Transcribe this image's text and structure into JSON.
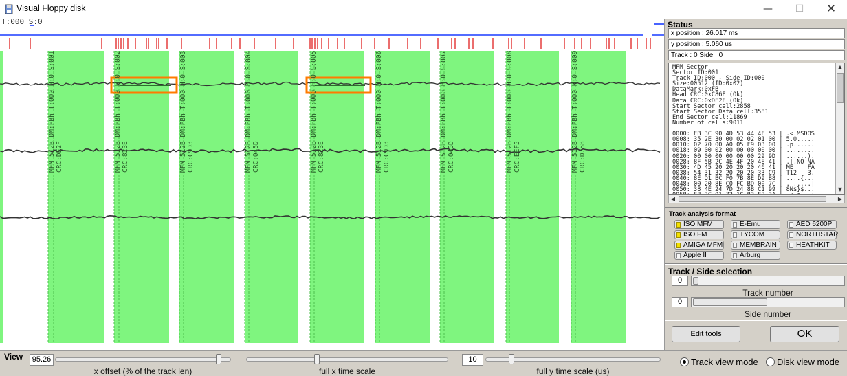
{
  "window": {
    "title": "Visual Floppy disk",
    "minimize": "—",
    "maximize": "☐",
    "close": "✕"
  },
  "trackview": {
    "readout": "T:000 S:0",
    "sector_labels": [
      "MFM 512B DM:FBh T:000 H:0 S:001 CRC:DE2F",
      "MFM 512B DM:FBh T:000 H:0 S:002 CRC:823E",
      "MFM 512B DM:FBh T:000 H:0 S:003 CRC:C9D3",
      "MFM 512B DM:FBh T:000 H:0 S:004 CRC:045D",
      "MFM 512B DM:FBh T:000 H:0 S:005 CRC:823E",
      "MFM 512B DM:FBh T:000 H:0 S:006 CRC:C9D3",
      "MFM 512B DM:FBh T:000 H:0 S:007 CRC:045D",
      "MFM 512B DM:FBh T:000 H:0 S:008 CRC:EEF5",
      "MFM 512B DM:FBh T:000 H:0 S:009 CRC:D758"
    ],
    "colors": {
      "sector": "#7ff57f",
      "marker": "#e02020",
      "highlight": "#ff7b00",
      "baseline": "#1a3cff"
    }
  },
  "status": {
    "title": "Status",
    "x_position": "x position : 26.017 ms",
    "y_position": "y position : 5.060 us",
    "track_side": "Track : 0 Side : 0",
    "info_lines": [
      "MFM Sector",
      "Sector ID:001",
      "Track ID:000 - Side ID:000",
      "Size:00512 (ID:0x02)",
      "DataMark:0xFB",
      "Head CRC:0xC86F (Ok)",
      "Data CRC:0xDE2F (Ok)",
      "Start Sector cell:2858",
      "Start Sector Data cell:3581",
      "End Sector cell:11869",
      "Number of cells:9011",
      "",
      "0000: EB 3C 90 4D 53 44 4F 53 | .<.MSDOS",
      "0008: 35 2E 30 00 02 02 01 00 | 5.0.....",
      "0010: 02 70 00 A0 05 F9 03 00 | .p......",
      "0018: 09 00 02 00 00 00 00 00 | ........",
      "0020: 00 00 00 00 00 00 29 9D | ......).",
      "0028: 8F 5B 2C 4E 4F 20 4E 41 | .[,NO NA",
      "0030: 4D 45 20 20 20 20 46 41 | ME    FA",
      "0038: 54 31 32 20 20 20 33 C9 | T12   3.",
      "0040: 8E D1 BC F0 7B 8E D9 B8 | ....{...",
      "0048: 00 20 8E C0 FC BD 00 7C | . .....|",
      "0050: 38 4E 24 7D 24 8B C1 99 | 8N$}$...",
      "0058: E8 3C 01 72 1C 83 EB 3A | .<.r...:"
    ]
  },
  "format": {
    "title": "Track analysis format",
    "buttons": [
      {
        "label": "ISO MFM",
        "on": true
      },
      {
        "label": "E-Emu",
        "on": false
      },
      {
        "label": "AED 6200P",
        "on": false
      },
      {
        "label": "ISO FM",
        "on": true
      },
      {
        "label": "TYCOM",
        "on": false
      },
      {
        "label": "NORTHSTAR",
        "on": false
      },
      {
        "label": "AMIGA MFM",
        "on": true
      },
      {
        "label": "MEMBRAIN",
        "on": false
      },
      {
        "label": "HEATHKIT",
        "on": false
      },
      {
        "label": "Apple II",
        "on": false
      },
      {
        "label": "Arburg",
        "on": false
      }
    ]
  },
  "trackside": {
    "title": "Track / Side selection",
    "track_value": "0",
    "track_label": "Track number",
    "side_value": "0",
    "side_label": "Side number"
  },
  "buttons": {
    "edit_tools": "Edit tools",
    "ok": "OK"
  },
  "view": {
    "title": "View",
    "x_offset_value": "95.26",
    "x_offset_label": "x offset (% of the track len)",
    "x_offset_level": 0.95,
    "x_time_label": "full x time scale",
    "x_time_level": 0.35,
    "y_scale_value": "10",
    "y_scale_label": "full y time scale (us)",
    "y_scale_level": 0.14,
    "track_view_mode": "Track view mode",
    "disk_view_mode": "Disk view mode",
    "mode_selected": "track"
  }
}
